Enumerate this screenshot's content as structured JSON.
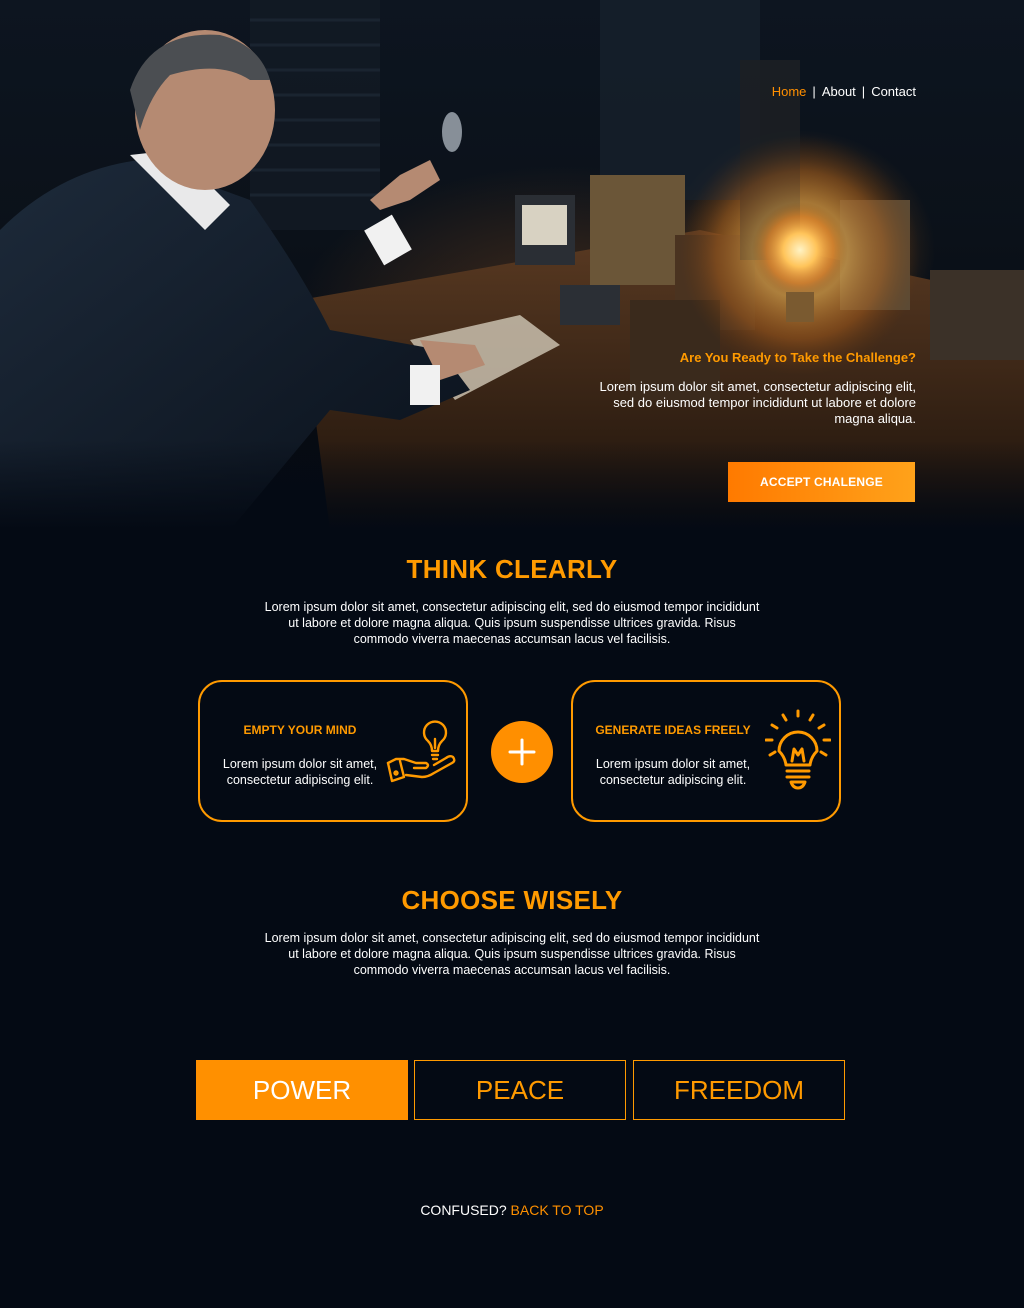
{
  "nav": {
    "items": [
      {
        "label": "Home",
        "active": true
      },
      {
        "label": "About",
        "active": false
      },
      {
        "label": "Contact",
        "active": false
      }
    ],
    "separator": "|"
  },
  "hero": {
    "image_description": "man in suit holding a light bulb at a desk with vintage electrical instruments and a glowing bulb",
    "tagline": "Are You Ready to Take the Challenge?",
    "text": "Lorem ipsum dolor sit amet, consectetur adipiscing elit, sed do eiusmod tempor incididunt ut labore et dolore magna aliqua.",
    "cta_label": "ACCEPT CHALENGE"
  },
  "think_clearly": {
    "title": "THINK CLEARLY",
    "text": "Lorem ipsum dolor sit amet, consectetur adipiscing elit, sed do eiusmod tempor incididunt ut labore et dolore magna aliqua. Quis ipsum suspendisse ultrices gravida. Risus commodo viverra maecenas accumsan lacus vel facilisis.",
    "cards": [
      {
        "title": "EMPTY YOUR MIND",
        "text": "Lorem ipsum dolor sit amet, consectetur adipiscing elit.",
        "icon": "hand-lightbulb-icon"
      },
      {
        "title": "GENERATE IDEAS FREELY",
        "text": "Lorem ipsum dolor sit amet, consectetur adipiscing elit.",
        "icon": "glowing-lightbulb-icon"
      }
    ],
    "plus_icon": "plus-icon"
  },
  "choose_wisely": {
    "title": "CHOOSE WISELY",
    "text": "Lorem ipsum dolor sit amet, consectetur adipiscing elit, sed do eiusmod tempor incididunt ut labore et dolore magna aliqua. Quis ipsum suspendisse ultrices gravida. Risus commodo viverra maecenas accumsan lacus vel facilisis.",
    "options": [
      {
        "label": "POWER",
        "selected": true
      },
      {
        "label": "PEACE",
        "selected": false
      },
      {
        "label": "FREEDOM",
        "selected": false
      }
    ]
  },
  "footer": {
    "label": "CONFUSED?",
    "link": "BACK TO TOP"
  },
  "colors": {
    "background": "#040a14",
    "accent": "#ff9000",
    "text": "#ffffff"
  }
}
